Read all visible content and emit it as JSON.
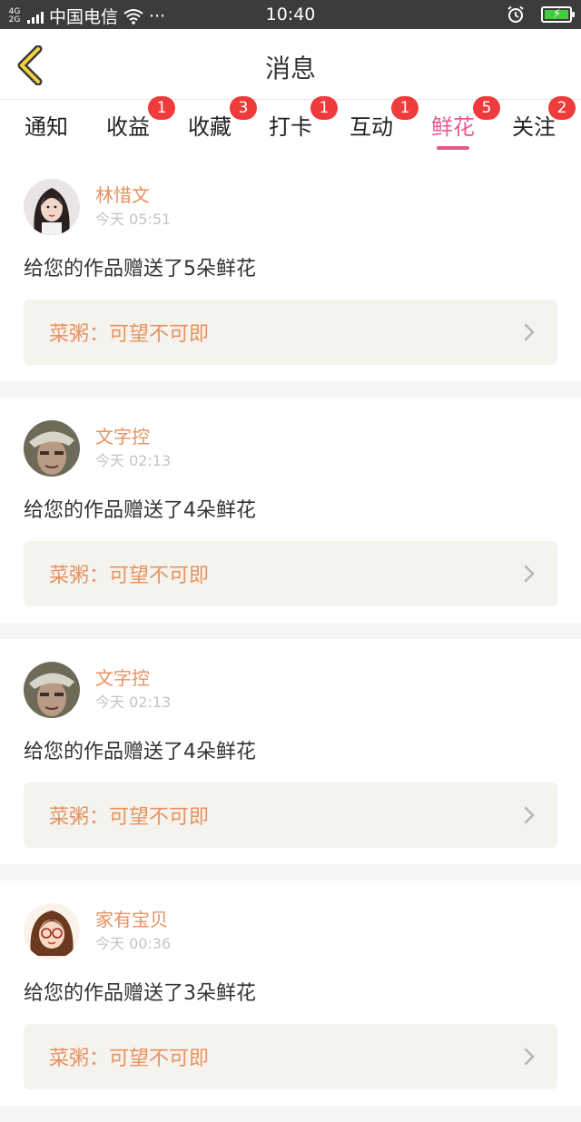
{
  "status_bar": {
    "network": "4G 2G",
    "carrier": "中国电信",
    "time": "10:40",
    "dots": "···"
  },
  "header": {
    "title": "消息"
  },
  "tabs": [
    {
      "label": "通知",
      "badge": ""
    },
    {
      "label": "收益",
      "badge": "1"
    },
    {
      "label": "收藏",
      "badge": "3"
    },
    {
      "label": "打卡",
      "badge": "1"
    },
    {
      "label": "互动",
      "badge": "1"
    },
    {
      "label": "鲜花",
      "badge": "5",
      "active": true
    },
    {
      "label": "关注",
      "badge": "2"
    }
  ],
  "feed": [
    {
      "username": "林惜文",
      "time": "今天 05:51",
      "message": "给您的作品赠送了5朵鲜花",
      "work": "菜粥：可望不可即"
    },
    {
      "username": "文字控",
      "time": "今天 02:13",
      "message": "给您的作品赠送了4朵鲜花",
      "work": "菜粥：可望不可即"
    },
    {
      "username": "文字控",
      "time": "今天 02:13",
      "message": "给您的作品赠送了4朵鲜花",
      "work": "菜粥：可望不可即"
    },
    {
      "username": "家有宝贝",
      "time": "今天 00:36",
      "message": "给您的作品赠送了3朵鲜花",
      "work": "菜粥：可望不可即"
    }
  ],
  "colors": {
    "accent": "#e8588f",
    "username": "#e9915f",
    "badge": "#ef3b3b",
    "link_bg": "#f4f3ed"
  }
}
